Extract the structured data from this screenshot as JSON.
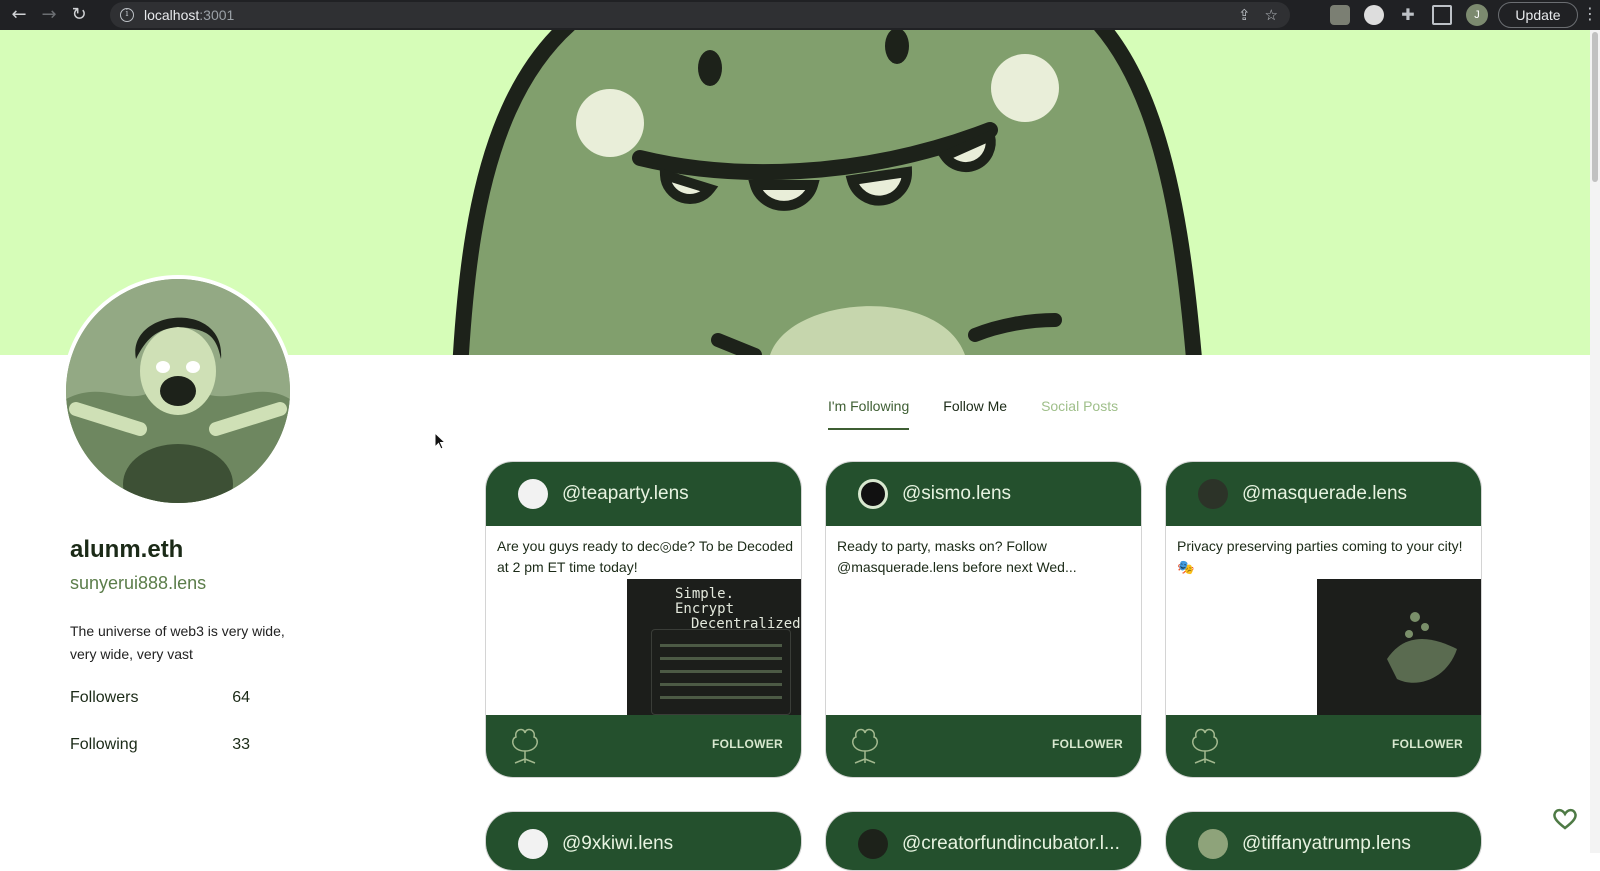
{
  "browser": {
    "url_host": "localhost",
    "url_port": ":3001",
    "update_label": "Update",
    "profile_initial": "J"
  },
  "profile": {
    "name": "alunm.eth",
    "handle": "sunyerui888.lens",
    "bio": "The universe of web3 is very wide, very wide, very vast",
    "followers_label": "Followers",
    "followers_count": "64",
    "following_label": "Following",
    "following_count": "33"
  },
  "tabs": [
    {
      "label": "I'm Following"
    },
    {
      "label": "Follow Me"
    },
    {
      "label": "Social Posts"
    }
  ],
  "cards": [
    {
      "handle": "@teaparty.lens",
      "text": "Are you guys ready to dec◎de? To be Decoded at 2 pm ET time today!",
      "action": "FOLLOWER",
      "image_text_1": "Simple. Encrypt",
      "image_text_2": "Decentralized"
    },
    {
      "handle": "@sismo.lens",
      "text": "Ready to party, masks on? Follow @masquerade.lens before next Wed...",
      "action": "FOLLOWER"
    },
    {
      "handle": "@masquerade.lens",
      "text": "Privacy preserving parties coming to your city! 🎭",
      "action": "FOLLOWER"
    },
    {
      "handle": "@9xkiwi.lens"
    },
    {
      "handle": "@creatorfundincubator.l..."
    },
    {
      "handle": "@tiffanyatrump.lens"
    }
  ],
  "colors": {
    "banner": "#d6fdb8",
    "card_green": "#24502d",
    "accent": "#3e5e33"
  }
}
